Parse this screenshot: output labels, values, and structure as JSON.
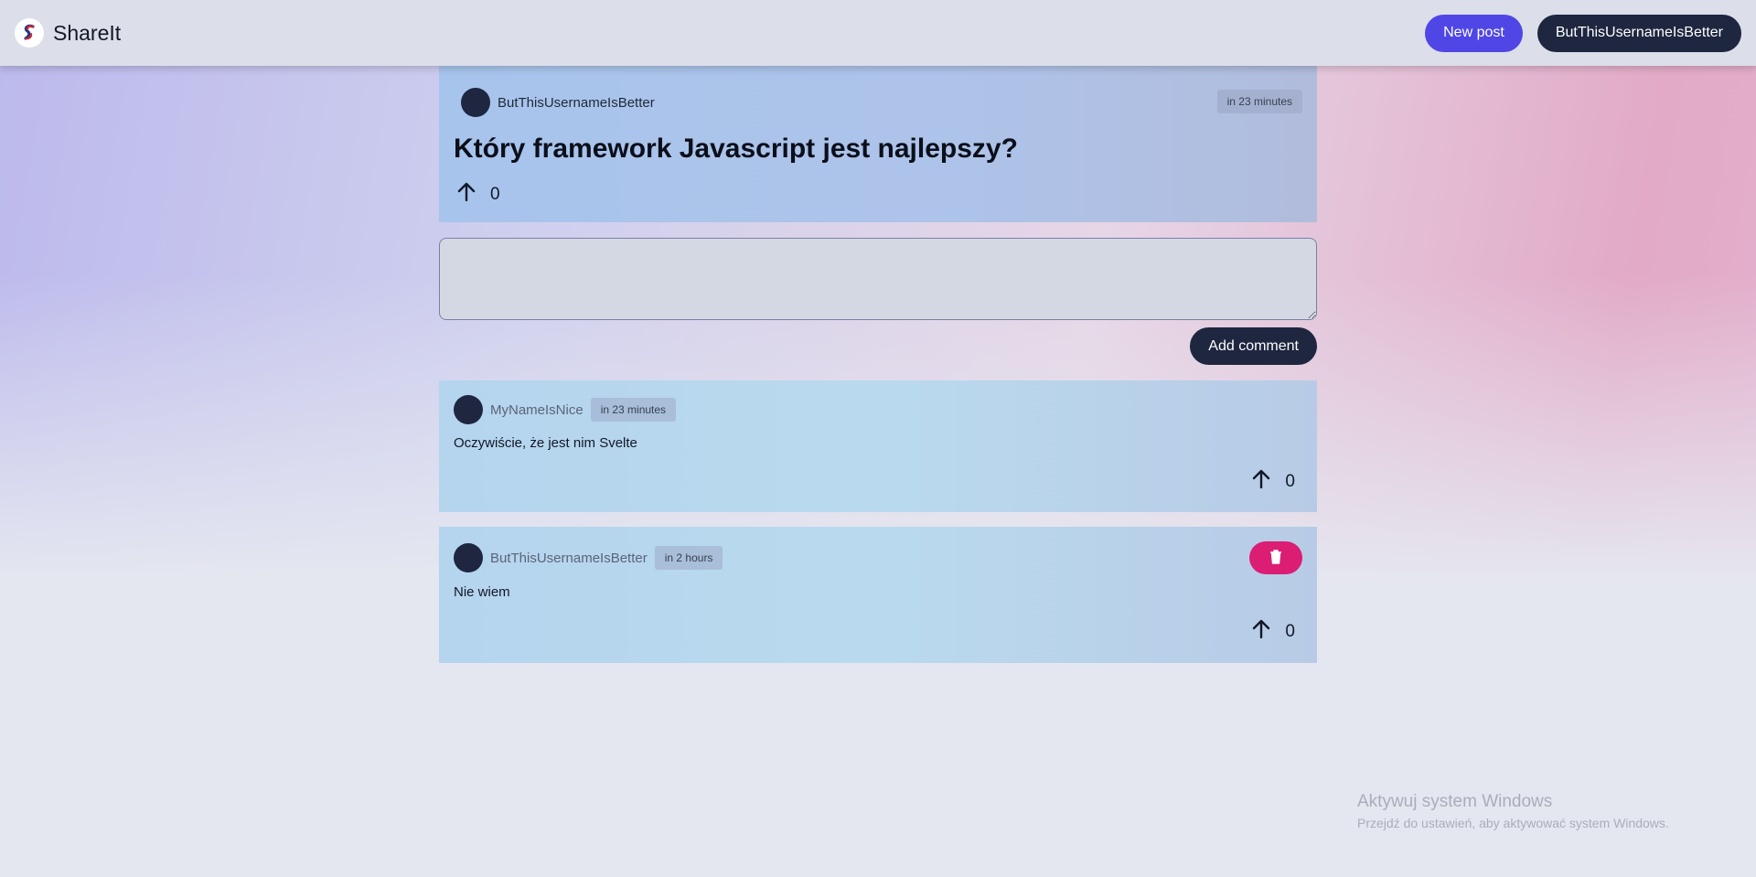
{
  "app": {
    "name": "ShareIt",
    "icon": "shareit-logo-icon"
  },
  "header": {
    "new_post_label": "New post",
    "user_label": "ButThisUsernameIsBetter"
  },
  "post": {
    "author": "ButThisUsernameIsBetter",
    "time": "in 23 minutes",
    "title": "Który framework Javascript jest najlepszy?",
    "votes": "0"
  },
  "comment_form": {
    "value": "",
    "placeholder": "",
    "submit_label": "Add comment"
  },
  "comments": [
    {
      "author": "MyNameIsNice",
      "time": "in 23 minutes",
      "text": "Oczywiście, że jest nim Svelte",
      "votes": "0",
      "can_delete": false
    },
    {
      "author": "ButThisUsernameIsBetter",
      "time": "in 2 hours",
      "text": "Nie wiem",
      "votes": "0",
      "can_delete": true
    }
  ],
  "watermark": {
    "title": "Aktywuj system Windows",
    "subtitle": "Przejdź do ustawień, aby aktywować system Windows."
  },
  "colors": {
    "accent": "#4f46e5",
    "dark": "#1e2640",
    "danger": "#db1d74"
  }
}
